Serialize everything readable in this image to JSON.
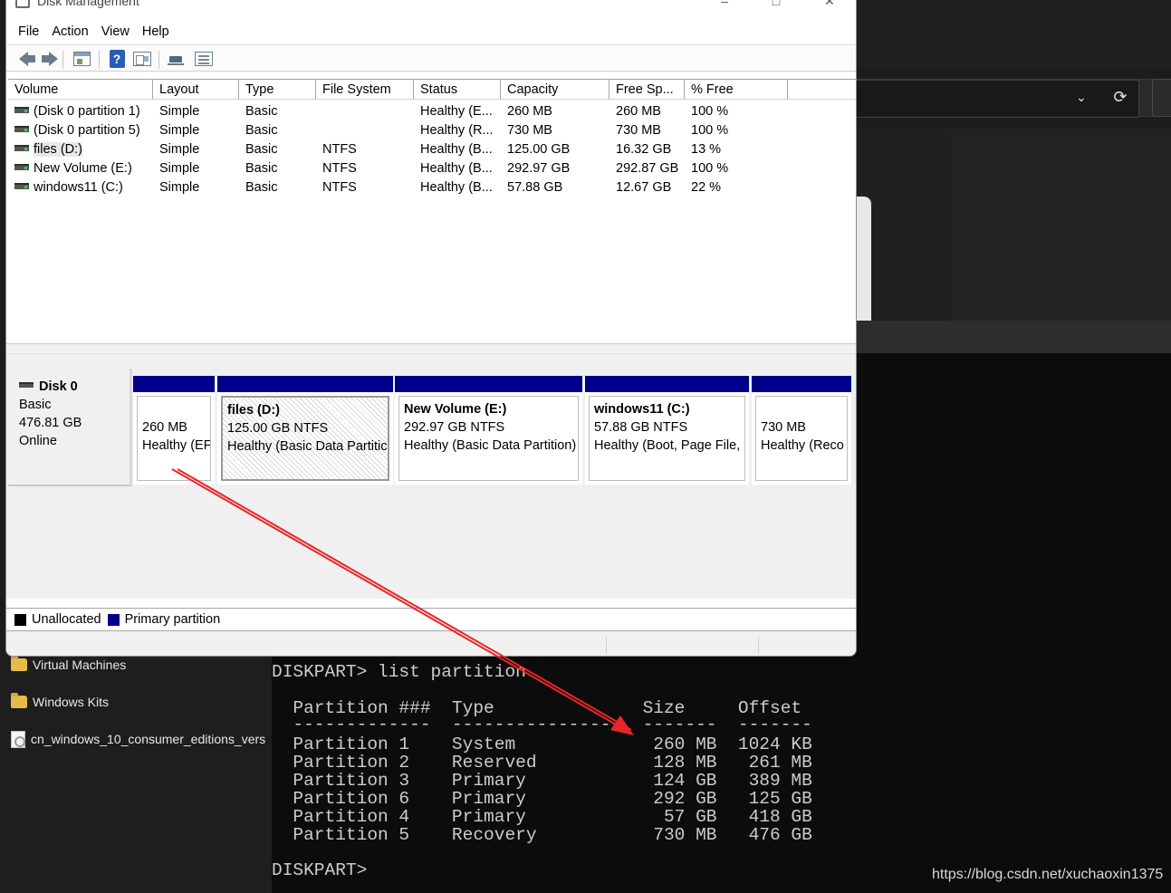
{
  "window": {
    "title": "Disk Management",
    "menu": [
      "File",
      "Action",
      "View",
      "Help"
    ]
  },
  "volume_table": {
    "columns": [
      "Volume",
      "Layout",
      "Type",
      "File System",
      "Status",
      "Capacity",
      "Free Sp...",
      "% Free"
    ],
    "rows": [
      {
        "volume": "(Disk 0 partition 1)",
        "layout": "Simple",
        "type": "Basic",
        "fs": "",
        "status": "Healthy (E...",
        "capacity": "260 MB",
        "free": "260 MB",
        "pct": "100 %"
      },
      {
        "volume": "(Disk 0 partition 5)",
        "layout": "Simple",
        "type": "Basic",
        "fs": "",
        "status": "Healthy (R...",
        "capacity": "730 MB",
        "free": "730 MB",
        "pct": "100 %"
      },
      {
        "volume": "files (D:)",
        "layout": "Simple",
        "type": "Basic",
        "fs": "NTFS",
        "status": "Healthy (B...",
        "capacity": "125.00 GB",
        "free": "16.32 GB",
        "pct": "13 %"
      },
      {
        "volume": "New Volume (E:)",
        "layout": "Simple",
        "type": "Basic",
        "fs": "NTFS",
        "status": "Healthy (B...",
        "capacity": "292.97 GB",
        "free": "292.87 GB",
        "pct": "100 %"
      },
      {
        "volume": "windows11 (C:)",
        "layout": "Simple",
        "type": "Basic",
        "fs": "NTFS",
        "status": "Healthy (B...",
        "capacity": "57.88 GB",
        "free": "12.67 GB",
        "pct": "22 %"
      }
    ]
  },
  "disk": {
    "name": "Disk 0",
    "type": "Basic",
    "size": "476.81 GB",
    "state": "Online",
    "partitions": [
      {
        "title": "",
        "size": "260 MB",
        "status": "Healthy (EF"
      },
      {
        "title": "files  (D:)",
        "size": "125.00 GB NTFS",
        "status": "Healthy (Basic Data Partitic"
      },
      {
        "title": "New Volume  (E:)",
        "size": "292.97 GB NTFS",
        "status": "Healthy (Basic Data Partition)"
      },
      {
        "title": "windows11  (C:)",
        "size": "57.88 GB NTFS",
        "status": "Healthy (Boot, Page File,"
      },
      {
        "title": "",
        "size": "730 MB",
        "status": "Healthy (Reco"
      }
    ]
  },
  "legend": {
    "unallocated": "Unallocated",
    "primary": "Primary partition",
    "colors": {
      "unallocated": "#000000",
      "primary": "#00008b"
    }
  },
  "explorer_sidebar": {
    "items": [
      {
        "icon": "folder-icon",
        "label": "Virtual Machines"
      },
      {
        "icon": "folder-icon",
        "label": "Windows Kits"
      },
      {
        "icon": "file-icon",
        "label": "cn_windows_10_consumer_editions_vers"
      }
    ]
  },
  "console": {
    "command": "DISKPART> list partition",
    "header": "  Partition ###  Type              Size     Offset",
    "divider": "  -------------  ----------------  -------  -------",
    "rows": [
      "  Partition 1    System             260 MB  1024 KB",
      "  Partition 2    Reserved           128 MB   261 MB",
      "  Partition 3    Primary            124 GB   389 MB",
      "  Partition 6    Primary            292 GB   125 GB",
      "  Partition 4    Primary             57 GB   418 GB",
      "  Partition 5    Recovery           730 MB   476 GB"
    ],
    "prompt": "DISKPART>"
  },
  "watermark": "https://blog.csdn.net/xuchaoxin1375",
  "annotation_color": "#e8262a"
}
